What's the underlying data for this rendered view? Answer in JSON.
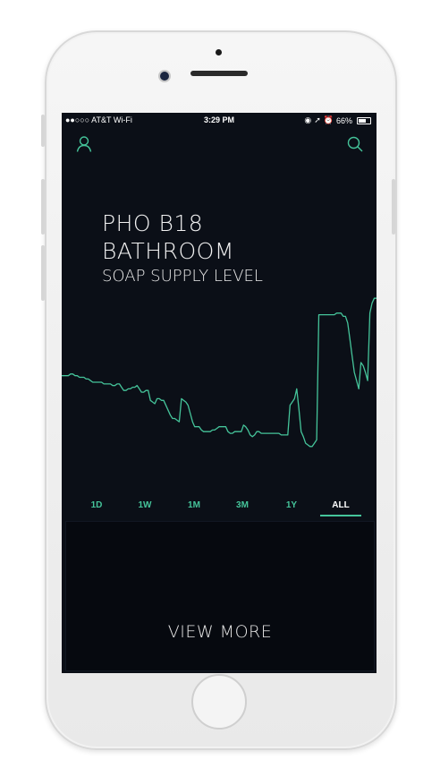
{
  "status_bar": {
    "carrier": "●●○○○ AT&T Wi-Fi",
    "time": "3:29 PM",
    "battery": "66%",
    "battery_level": 0.66
  },
  "header": {
    "title_line1": "PHO B18",
    "title_line2": "BATHROOM",
    "subtitle": "SOAP SUPPLY LEVEL"
  },
  "chart_data": {
    "type": "line",
    "color": "#45c49a",
    "series": [
      {
        "values": [
          48,
          48,
          48,
          48,
          49,
          49,
          48,
          48,
          47,
          47,
          47,
          46,
          46,
          45,
          44,
          44,
          44,
          44,
          44,
          43,
          43,
          43,
          43,
          42,
          42,
          43,
          43,
          41,
          39,
          39,
          40,
          40,
          41,
          41,
          42,
          40,
          38,
          38,
          39,
          39,
          33,
          32,
          31,
          34,
          34,
          33,
          33,
          30,
          27,
          24,
          22,
          22,
          21,
          20,
          34,
          33,
          32,
          30,
          25,
          20,
          17,
          17,
          17,
          15,
          14,
          14,
          14,
          14,
          15,
          15,
          16,
          17,
          17,
          17,
          17,
          14,
          13,
          13,
          14,
          14,
          14,
          14,
          18,
          17,
          15,
          12,
          11,
          12,
          14,
          14,
          13,
          13,
          13,
          13,
          13,
          13,
          13,
          13,
          13,
          12,
          12,
          12,
          12,
          30,
          32,
          34,
          40,
          28,
          14,
          11,
          7,
          6,
          5,
          5,
          7,
          9,
          85,
          85,
          85,
          85,
          85,
          85,
          85,
          85,
          86,
          86,
          86,
          84,
          84,
          80,
          70,
          60,
          50,
          45,
          40,
          56,
          54,
          50,
          45,
          86,
          92,
          95,
          95
        ]
      }
    ],
    "grid": false,
    "legend": "none"
  },
  "range_tabs": [
    {
      "label": "1D"
    },
    {
      "label": "1W"
    },
    {
      "label": "1M"
    },
    {
      "label": "3M"
    },
    {
      "label": "1Y"
    },
    {
      "label": "ALL"
    }
  ],
  "active_tab": "ALL",
  "panel": {
    "view_more_label": "VIEW MORE"
  },
  "icons": {
    "user": "user-icon",
    "search": "search-icon"
  },
  "colors": {
    "accent": "#45c49a",
    "background": "#0b0f17"
  }
}
